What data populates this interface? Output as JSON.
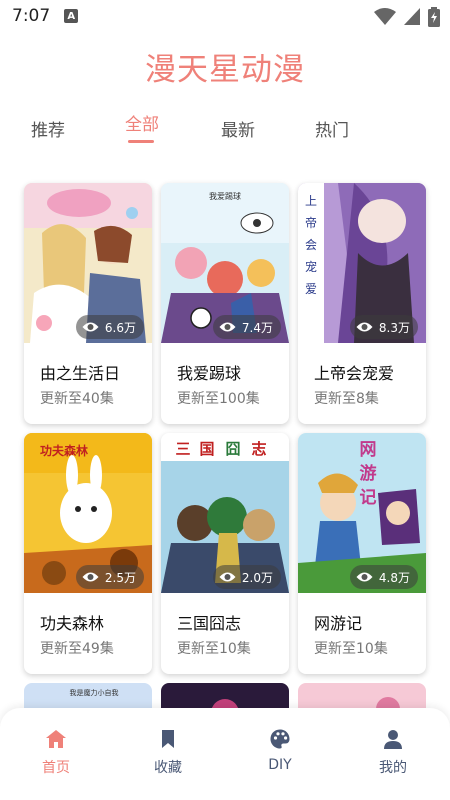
{
  "status": {
    "time": "7:07",
    "notif_letter": "A"
  },
  "app": {
    "title": "漫天星动漫"
  },
  "tabs": [
    {
      "label": "推荐"
    },
    {
      "label": "全部",
      "active": true
    },
    {
      "label": "最新"
    },
    {
      "label": "热门"
    }
  ],
  "comics": [
    {
      "title": "由之生活日",
      "update": "更新至40集",
      "views": "6.6万"
    },
    {
      "title": "我爱踢球",
      "update": "更新至100集",
      "views": "7.4万"
    },
    {
      "title": "上帝会宠爱",
      "update": "更新至8集",
      "views": "8.3万"
    },
    {
      "title": "功夫森林",
      "update": "更新至49集",
      "views": "2.5万"
    },
    {
      "title": "三国囧志",
      "update": "更新至10集",
      "views": "2.0万"
    },
    {
      "title": "网游记",
      "update": "更新至10集",
      "views": "4.8万"
    }
  ],
  "cover_text": {
    "c2": "我爱踢球",
    "c3": [
      "上",
      "帝",
      "会",
      "宠",
      "爱"
    ],
    "c4": "功夫森林",
    "c5": [
      "三",
      "国",
      "囧",
      "志"
    ],
    "c6": [
      "网",
      "游",
      "记"
    ],
    "p1": "我是魔力小自我"
  },
  "nav": [
    {
      "label": "首页",
      "icon": "home-icon",
      "active": true
    },
    {
      "label": "收藏",
      "icon": "bookmark-icon"
    },
    {
      "label": "DIY",
      "icon": "palette-icon"
    },
    {
      "label": "我的",
      "icon": "user-icon"
    }
  ],
  "colors": {
    "accent": "#ef8179",
    "nav_text": "#4a5875"
  }
}
